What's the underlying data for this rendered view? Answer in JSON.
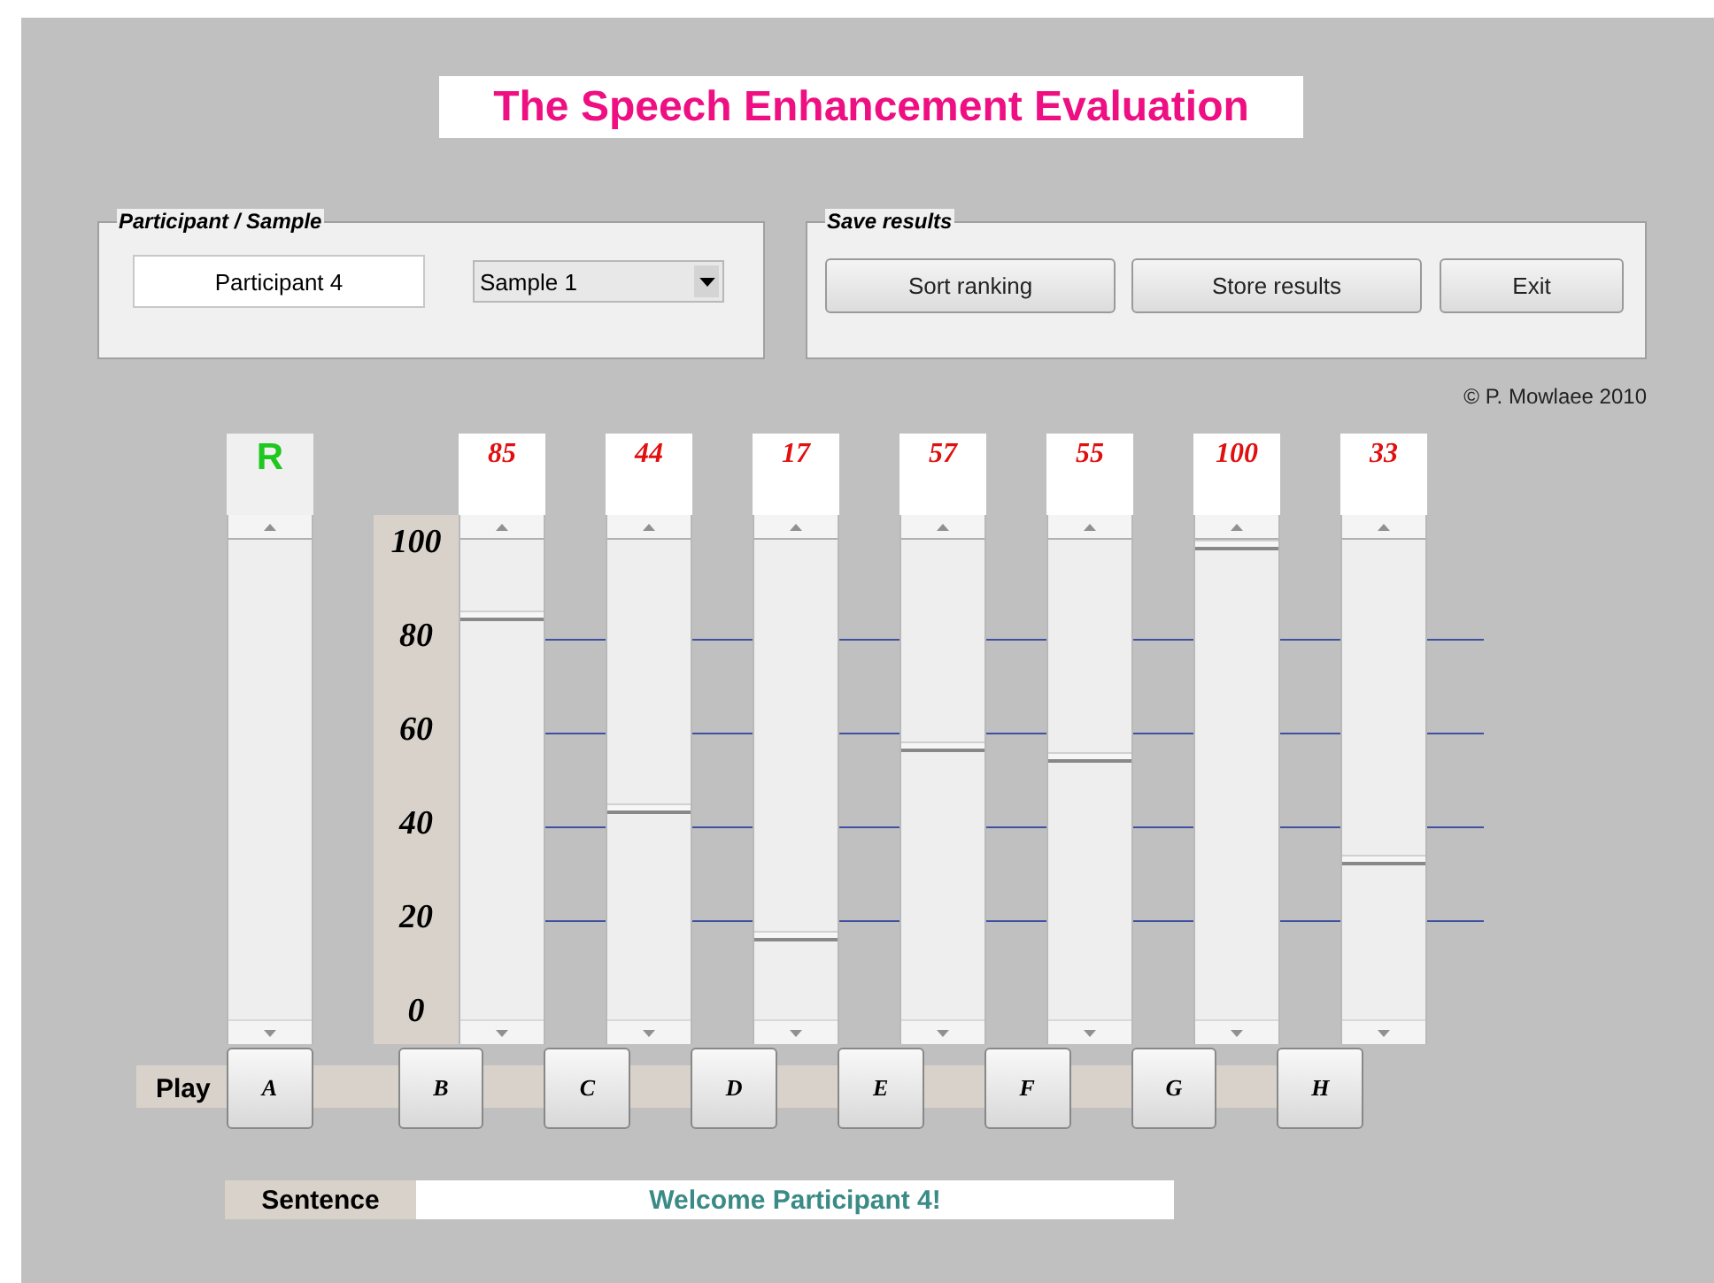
{
  "title": "The Speech Enhancement Evaluation",
  "participant_panel": {
    "legend": "Participant / Sample",
    "participant": "Participant 4",
    "sample": "Sample 1"
  },
  "save_panel": {
    "legend": "Save results",
    "buttons": [
      "Sort ranking",
      "Store results",
      "Exit"
    ]
  },
  "copyright": "©  P. Mowlaee 2010",
  "scale": {
    "labels": [
      "100",
      "80",
      "60",
      "40",
      "20",
      "0"
    ]
  },
  "sliders": [
    {
      "kind": "reference",
      "score": "R"
    },
    {
      "kind": "rating",
      "score": "85",
      "level": 0.85
    },
    {
      "kind": "rating",
      "score": "44",
      "level": 0.44
    },
    {
      "kind": "rating",
      "score": "17",
      "level": 0.17
    },
    {
      "kind": "rating",
      "score": "57",
      "level": 0.57
    },
    {
      "kind": "rating",
      "score": "55",
      "level": 0.55
    },
    {
      "kind": "rating",
      "score": "100",
      "level": 1.0
    },
    {
      "kind": "rating",
      "score": "33",
      "level": 0.33
    }
  ],
  "play": {
    "label": "Play",
    "buttons": [
      "A",
      "B",
      "C",
      "D",
      "E",
      "F",
      "G",
      "H"
    ]
  },
  "sentence": {
    "label": "Sentence",
    "text": "Welcome Participant 4!"
  }
}
